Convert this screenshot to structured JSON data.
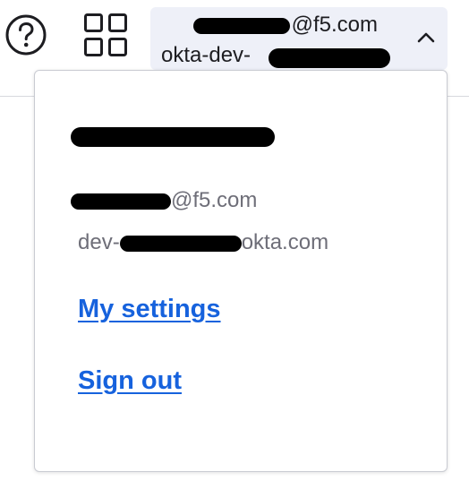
{
  "header": {
    "help_icon": "question-circle-icon",
    "apps_icon": "grid-icon",
    "account": {
      "email": "@f5.com",
      "org": "okta-dev-",
      "chevron_icon": "chevron-up-icon"
    }
  },
  "dropdown": {
    "email": "@f5.com",
    "org_prefix": "dev-",
    "org_suffix": "okta.com",
    "links": {
      "settings": "My settings",
      "signout": "Sign out"
    }
  },
  "colors": {
    "link": "#1662dd",
    "secondary_text": "#6e6e78",
    "primary_text": "#1d1d21",
    "toggle_bg": "#eef0f8",
    "redaction": "#000000"
  }
}
